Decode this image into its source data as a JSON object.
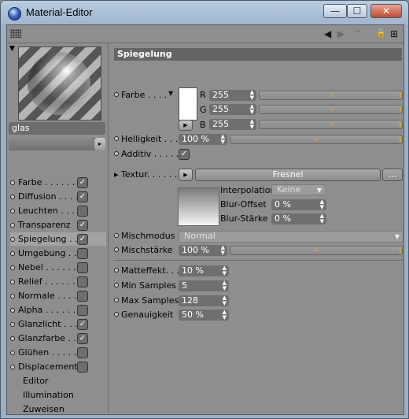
{
  "window": {
    "title": "Material-Editor",
    "min_label": "—",
    "max_label": "☐",
    "close_label": "✕"
  },
  "toolbar": {
    "back_glyph": "◀",
    "forward_glyph": "▶",
    "pin_glyph": "⌃",
    "lock_glyph": "🔒",
    "new_glyph": "⊞"
  },
  "material": {
    "name": "glas"
  },
  "channels": [
    {
      "label": "Farbe . . . . . .",
      "checked": true
    },
    {
      "label": "Diffusion . . . .",
      "checked": true
    },
    {
      "label": "Leuchten . . . .",
      "checked": false
    },
    {
      "label": "Transparenz",
      "checked": true
    },
    {
      "label": "Spiegelung . .",
      "checked": true,
      "selected": true
    },
    {
      "label": "Umgebung . .",
      "checked": false
    },
    {
      "label": "Nebel . . . . . .",
      "checked": false
    },
    {
      "label": "Relief . . . . . .",
      "checked": false
    },
    {
      "label": "Normale . . . .",
      "checked": false
    },
    {
      "label": "Alpha . . . . . .",
      "checked": false
    },
    {
      "label": "Glanzlicht . . .",
      "checked": true
    },
    {
      "label": "Glanzfarbe . .",
      "checked": true
    },
    {
      "label": "Glühen . . . . .",
      "checked": false
    },
    {
      "label": "Displacement",
      "checked": false
    }
  ],
  "extra_items": [
    "Editor",
    "Illumination",
    "Zuweisen"
  ],
  "check_glyph": "✓",
  "section": {
    "title": "Spiegelung"
  },
  "farbe": {
    "label": "Farbe . . . .",
    "r_label": "R",
    "g_label": "G",
    "b_label": "B",
    "r": "255",
    "g": "255",
    "b": "255"
  },
  "helligkeit": {
    "label": "Helligkeit . . .",
    "value": "100 %"
  },
  "additiv": {
    "label": "Additiv . . . . . ."
  },
  "textur": {
    "label": "Textur. . . . . . .",
    "shader": "Fresnel",
    "more": "...",
    "arrow": "▸"
  },
  "interpolation": {
    "label": "Interpolation",
    "value": "Keine"
  },
  "blur_offset": {
    "label": "Blur-Offset",
    "value": "0 %"
  },
  "blur_staerke": {
    "label": "Blur-Stärke",
    "value": "0 %"
  },
  "mischmodus": {
    "label": "Mischmodus",
    "value": "Normal"
  },
  "mischstaerke": {
    "label": "Mischstärke",
    "value": "100 %"
  },
  "matteffekt": {
    "label": "Matteffekt. . .",
    "value": "10 %"
  },
  "min_samples": {
    "label": "Min Samples",
    "value": "5"
  },
  "max_samples": {
    "label": "Max Samples",
    "value": "128"
  },
  "genauigkeit": {
    "label": "Genauigkeit",
    "value": "50 %"
  },
  "colors": {
    "accent": "#c9a23a",
    "panel": "#8e8e8e",
    "field": "#6f6f6f"
  }
}
